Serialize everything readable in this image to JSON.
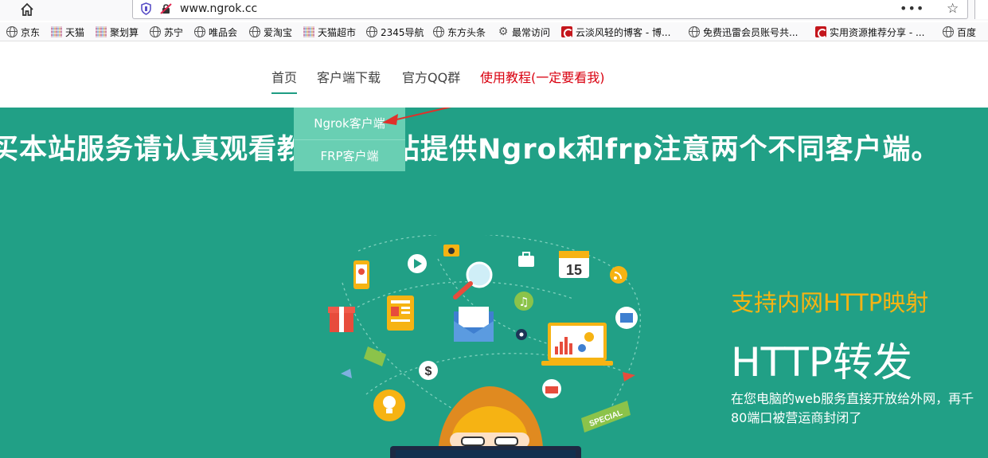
{
  "browser": {
    "url": "www.ngrok.cc",
    "more_label": "•••",
    "star_label": "☆"
  },
  "bookmarks": [
    {
      "label": "京东",
      "icon": "globe-icon"
    },
    {
      "label": "天猫",
      "icon": "favicon-pixel"
    },
    {
      "label": "聚划算",
      "icon": "favicon-pixel"
    },
    {
      "label": "苏宁",
      "icon": "globe-icon"
    },
    {
      "label": "唯品会",
      "icon": "globe-icon"
    },
    {
      "label": "爱淘宝",
      "icon": "globe-icon"
    },
    {
      "label": "天猫超市",
      "icon": "favicon-pixel"
    },
    {
      "label": "2345导航",
      "icon": "globe-icon"
    },
    {
      "label": "东方头条",
      "icon": "globe-icon"
    },
    {
      "label": "最常访问",
      "icon": "gear-icon"
    },
    {
      "label": "云淡风轻的博客 - 博...",
      "icon": "csdn-icon"
    },
    {
      "label": "免费迅雷会员账号共...",
      "icon": "globe-icon"
    },
    {
      "label": "实用资源推荐分享 - ...",
      "icon": "csdn-icon"
    },
    {
      "label": "百度",
      "icon": "globe-icon"
    }
  ],
  "nav": {
    "home": "首页",
    "download": "客户端下载",
    "qq_group": "官方QQ群",
    "tutorial": "使用教程(一定要看我)"
  },
  "dropdown": {
    "ngrok": "Ngrok客户端",
    "frp": "FRP客户端"
  },
  "hero": {
    "marquee": "买本站服务请认真观看教程，本站提供Ngrok和frp注意两个不同客户端。",
    "calendar_day": "15",
    "special_tag": "SPECIAL",
    "feature_sub": "支持内网HTTP映射",
    "feature_title": "HTTP转发",
    "feature_desc_1": "在您电脑的web服务直接开放给外网，再千",
    "feature_desc_2": "80端口被营运商封闭了"
  },
  "colors": {
    "hero_bg": "#21a086",
    "dropdown_bg": "#69cfb3",
    "accent_yellow": "#f6b313",
    "tutorial_red": "#d9000f"
  }
}
